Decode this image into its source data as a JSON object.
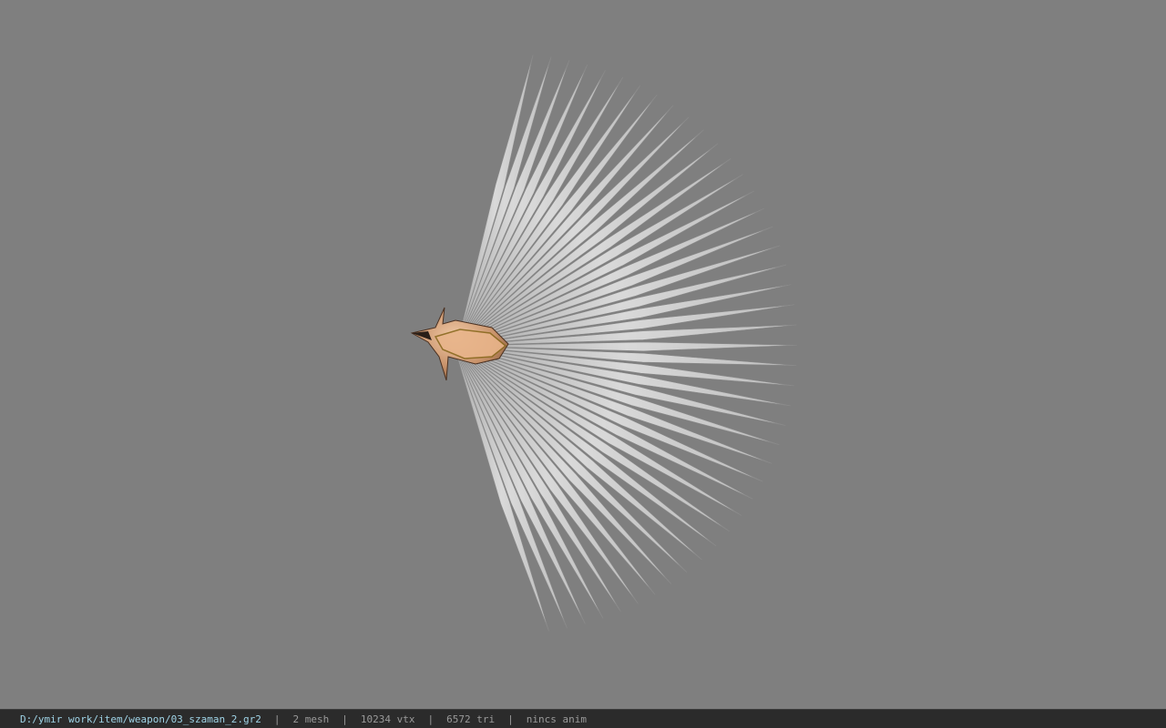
{
  "viewer": {
    "background_color": "#7f7f7f",
    "model_icon": "feather-fan-weapon-icon",
    "feather_color": "#c9c9c9",
    "handle_color": "#c8926a"
  },
  "status_bar": {
    "file_path": "D:/ymir work/item/weapon/03_szaman_2.gr2",
    "separator": "|",
    "mesh_count": "2 mesh",
    "vertex_count": "10234 vtx",
    "triangle_count": "6572 tri",
    "anim_status": "nincs anim",
    "path_color": "#9fd3e6"
  }
}
